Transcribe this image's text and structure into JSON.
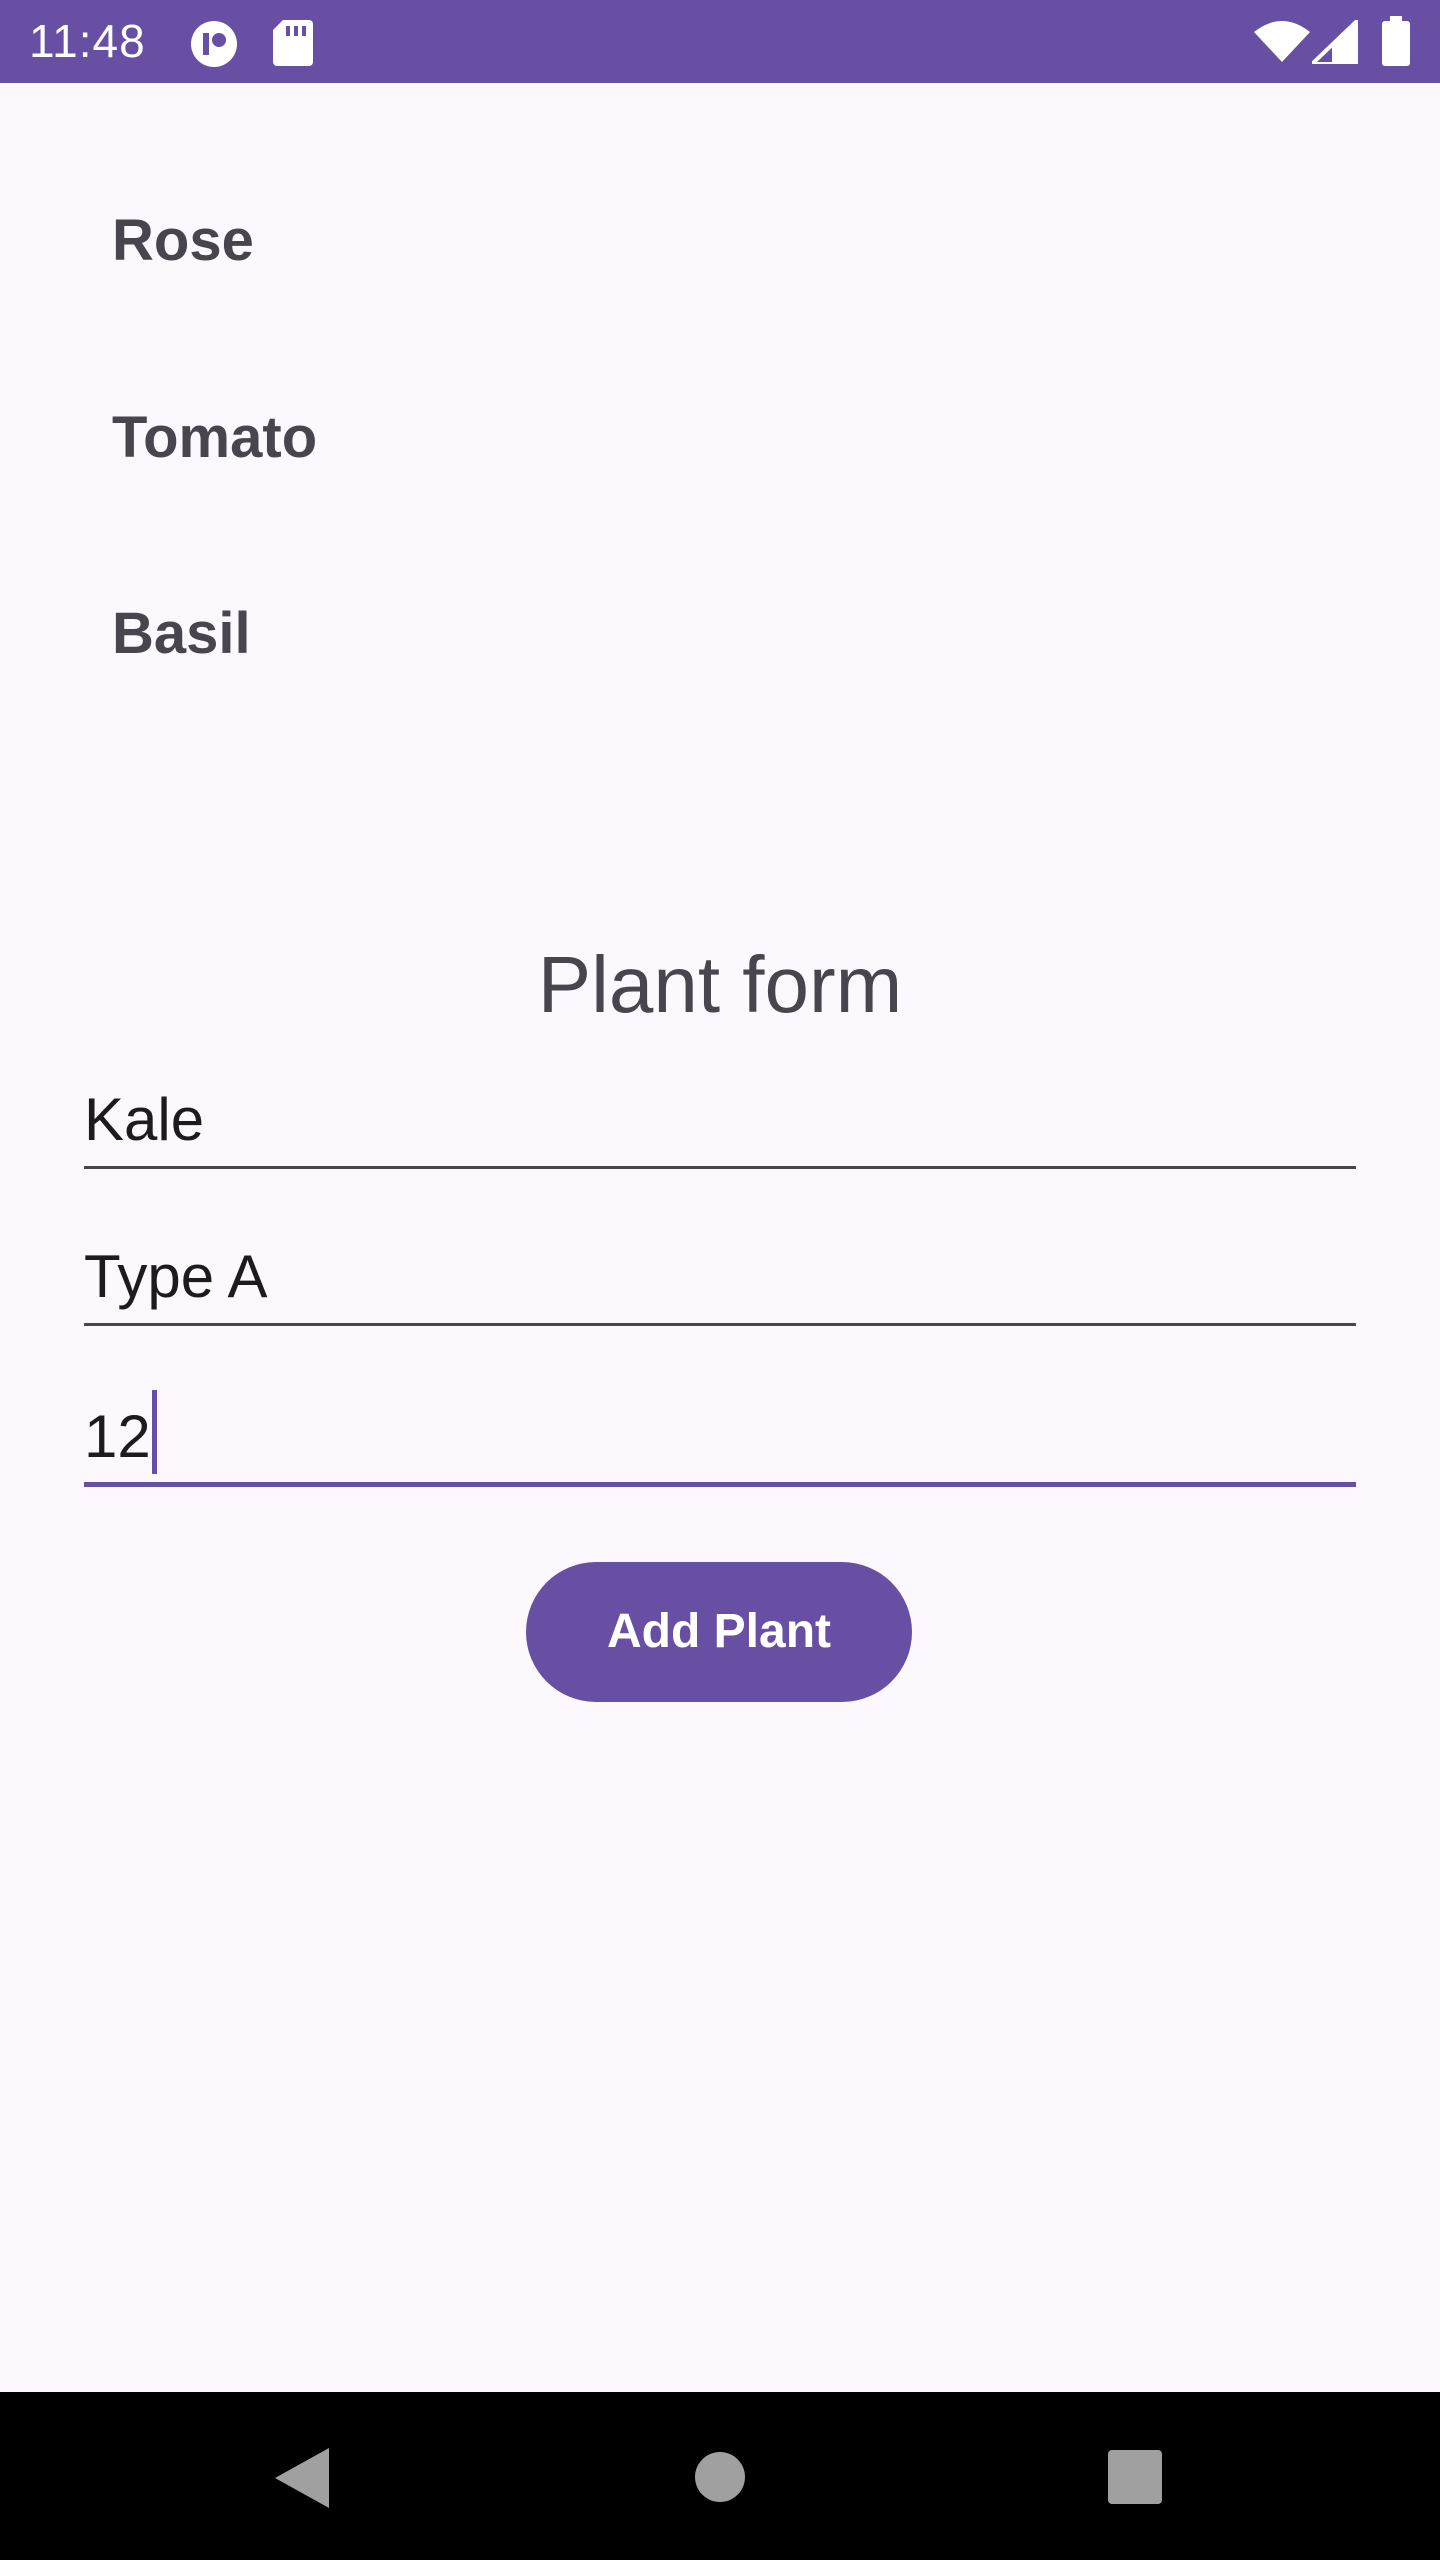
{
  "status_bar": {
    "time": "11:48",
    "icons": [
      "notification-app-icon",
      "sd-card-icon",
      "wifi-icon",
      "cellular-signal-icon",
      "battery-icon"
    ],
    "background_color": "#6750a4"
  },
  "plants": [
    {
      "name": "Rose"
    },
    {
      "name": "Tomato"
    },
    {
      "name": "Basil"
    }
  ],
  "form": {
    "title": "Plant form",
    "fields": {
      "name": {
        "value": "Kale"
      },
      "type": {
        "value": "Type A"
      },
      "quantity": {
        "value": "12",
        "focused": true
      }
    },
    "submit_label": "Add Plant"
  },
  "nav_bar": {
    "buttons": [
      "back-icon",
      "home-icon",
      "recents-icon"
    ]
  },
  "colors": {
    "primary": "#6750a4",
    "background": "#fdf7fe",
    "text": "#49454f"
  }
}
